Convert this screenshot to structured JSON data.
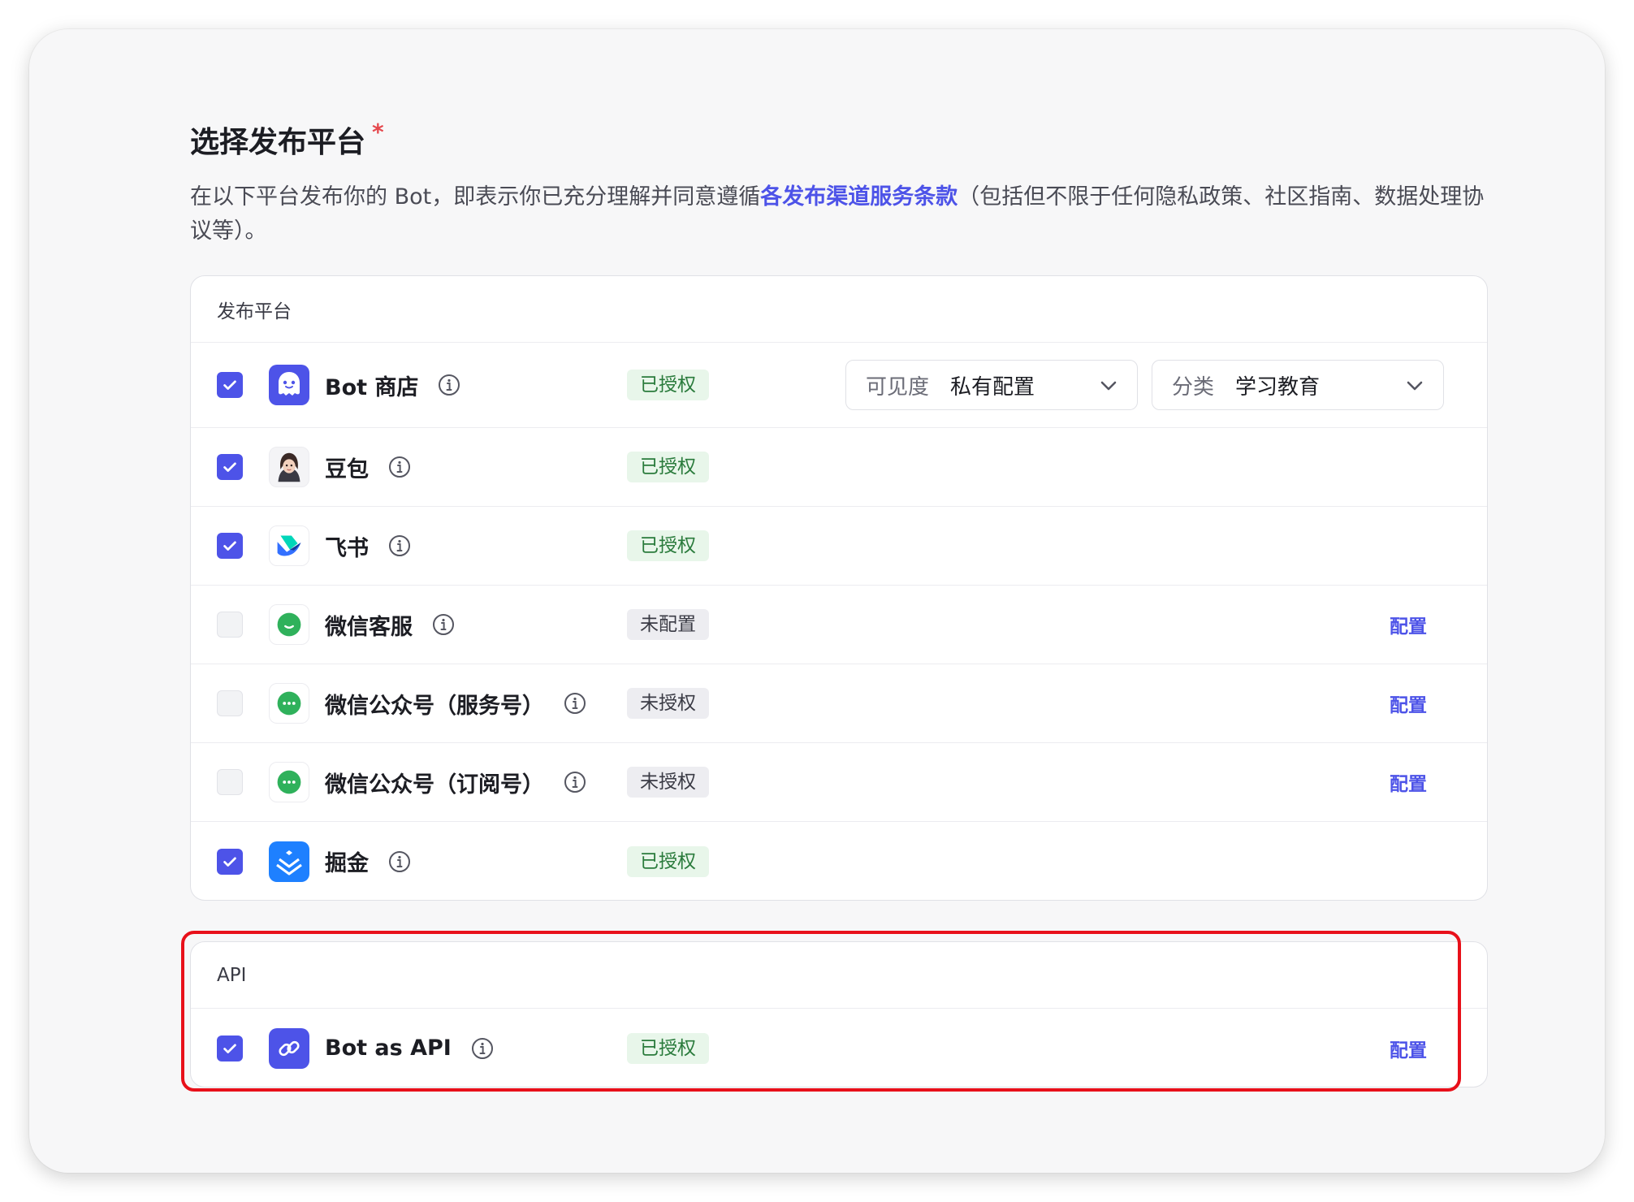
{
  "header": {
    "title": "选择发布平台",
    "required_mark": "*",
    "desc_before": "在以下平台发布你的 Bot，即表示你已充分理解并同意遵循",
    "desc_link": "各发布渠道服务条款",
    "desc_after": "（包括但不限于任何隐私政策、社区指南、数据处理协议等）。"
  },
  "platform_card": {
    "heading": "发布平台",
    "visibility_select": {
      "label": "可见度",
      "value": "私有配置"
    },
    "category_select": {
      "label": "分类",
      "value": "学习教育"
    },
    "rows": [
      {
        "name": "Bot 商店",
        "checked": true,
        "status": "已授权",
        "icon": "bot-store-icon"
      },
      {
        "name": "豆包",
        "checked": true,
        "status": "已授权",
        "icon": "doubao-avatar-icon"
      },
      {
        "name": "飞书",
        "checked": true,
        "status": "已授权",
        "icon": "feishu-icon"
      },
      {
        "name": "微信客服",
        "checked": false,
        "status": "未配置",
        "config": "配置",
        "icon": "wechat-service-icon"
      },
      {
        "name": "微信公众号（服务号）",
        "checked": false,
        "status": "未授权",
        "config": "配置",
        "icon": "wechat-icon"
      },
      {
        "name": "微信公众号（订阅号）",
        "checked": false,
        "status": "未授权",
        "config": "配置",
        "icon": "wechat-icon"
      },
      {
        "name": "掘金",
        "checked": true,
        "status": "已授权",
        "icon": "juejin-icon"
      }
    ]
  },
  "api_card": {
    "heading": "API",
    "row": {
      "name": "Bot as API",
      "checked": true,
      "status": "已授权",
      "config": "配置",
      "icon": "link-icon"
    }
  },
  "colors": {
    "accent": "#4d53e8",
    "authorized_bg": "#e8f6ea",
    "authorized_text": "#2a7b3c",
    "highlight": "#e8101a"
  }
}
